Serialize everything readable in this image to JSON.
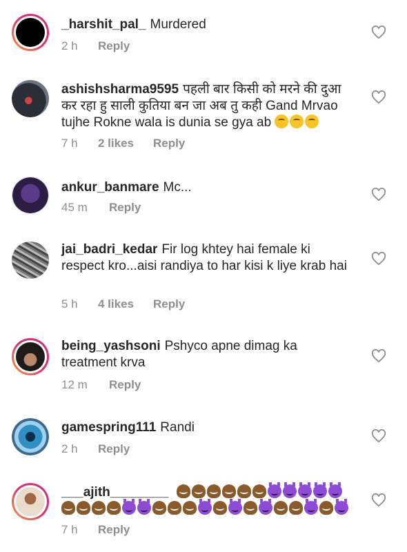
{
  "comments": [
    {
      "username": "_harshit_pal_",
      "text": "Murdered",
      "time": "2 h",
      "likes": "",
      "reply": "Reply"
    },
    {
      "username": "ashishsharma9595",
      "text": "पहली बार किसी को मरने की दुआ कर रहा हु साली कुतिया बन जा अब तु कही Gand Mrvao tujhe Rokne wala is dunia se gya ab",
      "emojis": [
        "crying-face",
        "crying-face",
        "crying-face"
      ],
      "time": "7 h",
      "likes": "2 likes",
      "reply": "Reply"
    },
    {
      "username": "ankur_banmare",
      "text": "Mc...",
      "time": "45 m",
      "likes": "",
      "reply": "Reply"
    },
    {
      "username": "jai_badri_kedar",
      "text": "Fir log khtey hai female ki respect kro...aisi randiya to har kisi k liye krab hai",
      "time": "5 h",
      "likes": "4 likes",
      "reply": "Reply"
    },
    {
      "username": "being_yashsoni",
      "text": "Pshyco apne dimag ka treatment krva",
      "time": "12 m",
      "likes": "",
      "reply": "Reply"
    },
    {
      "username": "gamespring111",
      "text": "Randi",
      "time": "2 h",
      "likes": "",
      "reply": "Reply"
    },
    {
      "username": "___ajith________",
      "text": "",
      "emojis": [
        "poop",
        "poop",
        "poop",
        "poop",
        "poop",
        "poop",
        "devil",
        "devil",
        "devil",
        "devil",
        "devil",
        "poop",
        "poop",
        "poop",
        "poop",
        "devil",
        "devil",
        "poop",
        "poop",
        "poop",
        "devil",
        "poop",
        "devil",
        "poop",
        "devil",
        "poop",
        "poop",
        "devil",
        "poop",
        "devil"
      ],
      "time": "7 h",
      "likes": "",
      "reply": "Reply"
    }
  ],
  "colors": {
    "text": "#262626",
    "meta": "#8e8e8e",
    "background": "#ffffff"
  }
}
